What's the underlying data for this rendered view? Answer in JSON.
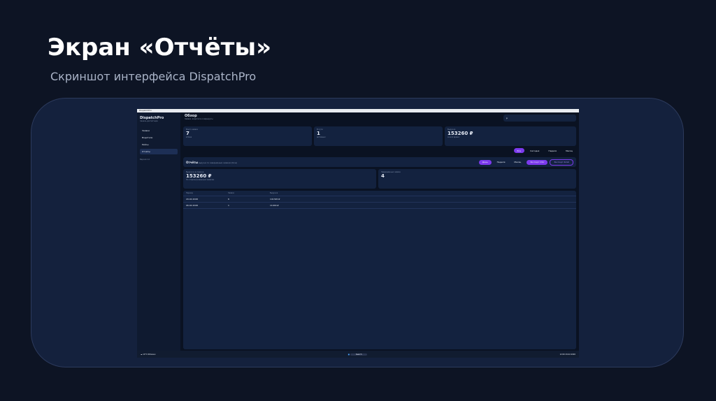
{
  "slide": {
    "title": "Экран «Отчёты»",
    "subtitle": "Скриншот интерфейса DispatchPro"
  },
  "window": {
    "title": "DispatchPro"
  },
  "sidebar": {
    "brand": "DispatchPro",
    "tagline": "панель диспетчера",
    "items": [
      {
        "label": "Заявки"
      },
      {
        "label": "Водители"
      },
      {
        "label": "Рейсы"
      },
      {
        "label": "Отчёты"
      }
    ],
    "version": "Версия 1.0"
  },
  "header": {
    "title": "Обзор",
    "subtitle": "Заявки, водители и маршруты",
    "search_value": "р"
  },
  "stats": [
    {
      "label": "Всего заявок",
      "value": "7",
      "note": "в базе"
    },
    {
      "label": "В пути",
      "value": "1",
      "note": "активных"
    },
    {
      "label": "Выручка",
      "value": "153260 ₽",
      "note": "за всё время"
    }
  ],
  "filters": [
    "Все",
    "Сегодня",
    "Неделя",
    "Месяц"
  ],
  "reports": {
    "title": "Отчёты",
    "subtitle": "выручка по завершённым заявкам (Done)",
    "periods": [
      "День",
      "Неделя",
      "Месяц"
    ],
    "export_csv": "Экспорт CSV",
    "export_xlsx": "Экспорт XLSX",
    "revenue_label": "Выручка за период",
    "revenue_value": "153260 ₽",
    "revenue_note": "По отфильтрованным заявкам",
    "done_label": "Завершённых заявок",
    "done_value": "4",
    "columns": [
      "Период",
      "Заявок",
      "Выручка"
    ],
    "rows": [
      [
        "29.02.2026",
        "6",
        "141320 ₽"
      ],
      [
        "06.02.2026",
        "1",
        "11940 ₽"
      ]
    ]
  },
  "taskbar": {
    "weather": "10°C",
    "weather_note": "Облачно",
    "search": "Search",
    "time": "12:00",
    "date": "29.02.2026"
  }
}
